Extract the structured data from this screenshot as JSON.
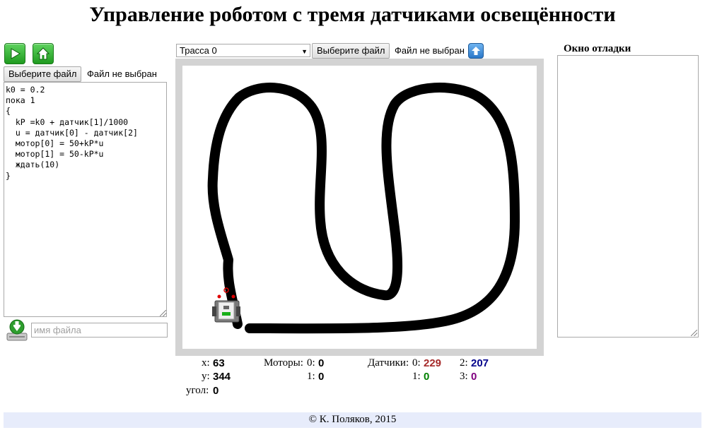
{
  "page": {
    "title": "Управление роботом с тремя датчиками освещённости"
  },
  "toolbar": {
    "run_icon": "play-icon",
    "home_icon": "home-icon"
  },
  "program": {
    "file_button": "Выберите файл",
    "file_status": "Файл не выбран",
    "code": "k0 = 0.2\nпока 1\n{\n  kP =k0 + датчик[1]/1000\n  u = датчик[0] - датчик[2]\n  мотор[0] = 50+kP*u\n  мотор[1] = 50-kP*u\n  ждать(10)\n}",
    "save_icon": "download-icon",
    "filename_placeholder": "имя файла"
  },
  "track": {
    "selected": "Трасса 0",
    "file_button": "Выберите файл",
    "file_status": "Файл не выбран",
    "upload_icon": "upload-icon"
  },
  "debug": {
    "title": "Окно отладки"
  },
  "status": {
    "x_label": "x:",
    "x_value": "63",
    "y_label": "y:",
    "y_value": "344",
    "angle_label": "угол:",
    "angle_value": "0",
    "motors_label": "Моторы:",
    "motor0_label": "0:",
    "motor0_value": "0",
    "motor1_label": "1:",
    "motor1_value": "0",
    "sensors_label": "Датчики:",
    "sensor0_label": "0:",
    "sensor0_value": "229",
    "sensor1_label": "1:",
    "sensor1_value": "0",
    "sensor2_label": "2:",
    "sensor2_value": "207",
    "sensor3_label": "3:",
    "sensor3_value": "0"
  },
  "colors": {
    "sensor0": "#a52a2a",
    "sensor1": "#008000",
    "sensor2": "#00008b",
    "sensor3": "#800080",
    "footer_bg": "#e7ecfb"
  },
  "footer": {
    "text": "© К. Поляков, 2015"
  }
}
